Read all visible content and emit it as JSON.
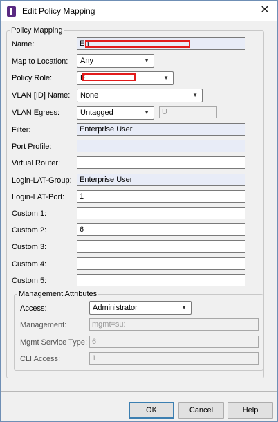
{
  "window": {
    "title": "Edit Policy Mapping",
    "close_glyph": "✕",
    "icon": "app-icon"
  },
  "policy_mapping": {
    "legend": "Policy Mapping",
    "name": {
      "label": "Name:",
      "value": "En"
    },
    "map_to_location": {
      "label": "Map to Location:",
      "value": "Any"
    },
    "policy_role": {
      "label": "Policy Role:",
      "value": "E"
    },
    "vlan_name": {
      "label": "VLAN [ID] Name:",
      "value": "None"
    },
    "vlan_egress": {
      "label": "VLAN Egress:",
      "value": "Untagged",
      "extra_value": "U"
    },
    "filter": {
      "label": "Filter:",
      "value": "Enterprise User"
    },
    "port_profile": {
      "label": "Port Profile:",
      "value": ""
    },
    "virtual_router": {
      "label": "Virtual Router:",
      "value": ""
    },
    "login_lat_group": {
      "label": "Login-LAT-Group:",
      "value": "Enterprise User"
    },
    "login_lat_port": {
      "label": "Login-LAT-Port:",
      "value": "1"
    },
    "custom1": {
      "label": "Custom 1:",
      "value": ""
    },
    "custom2": {
      "label": "Custom 2:",
      "value": "6"
    },
    "custom3": {
      "label": "Custom 3:",
      "value": ""
    },
    "custom4": {
      "label": "Custom 4:",
      "value": ""
    },
    "custom5": {
      "label": "Custom 5:",
      "value": ""
    }
  },
  "management": {
    "legend": "Management Attributes",
    "access": {
      "label": "Access:",
      "value": "Administrator"
    },
    "management": {
      "label": "Management:",
      "value": "mgmt=su:"
    },
    "mgmt_service_type": {
      "label": "Mgmt Service Type:",
      "value": "6"
    },
    "cli_access": {
      "label": "CLI Access:",
      "value": "1"
    }
  },
  "buttons": {
    "ok": "OK",
    "cancel": "Cancel",
    "help": "Help"
  },
  "colors": {
    "redaction": "#e21b1b",
    "tinted_field": "#e8ecf7",
    "dialog_bg": "#f0f0f0"
  }
}
